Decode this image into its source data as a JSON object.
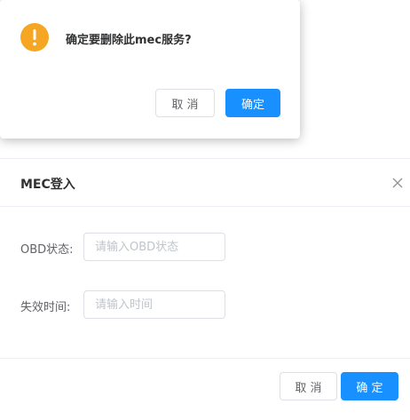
{
  "confirm": {
    "icon": "warning-icon",
    "message": "确定要删除此mec服务?",
    "cancel_label": "取 消",
    "ok_label": "确定",
    "icon_color": "#f5a623",
    "primary_color": "#1890ff"
  },
  "dialog": {
    "title": "MEC登入",
    "close_icon": "close-icon",
    "fields": [
      {
        "label": "OBD状态:",
        "placeholder": "请输入OBD状态",
        "value": ""
      },
      {
        "label": "失效时间:",
        "placeholder": "请输入时间",
        "value": ""
      }
    ],
    "cancel_label": "取 消",
    "ok_label": "确 定"
  }
}
